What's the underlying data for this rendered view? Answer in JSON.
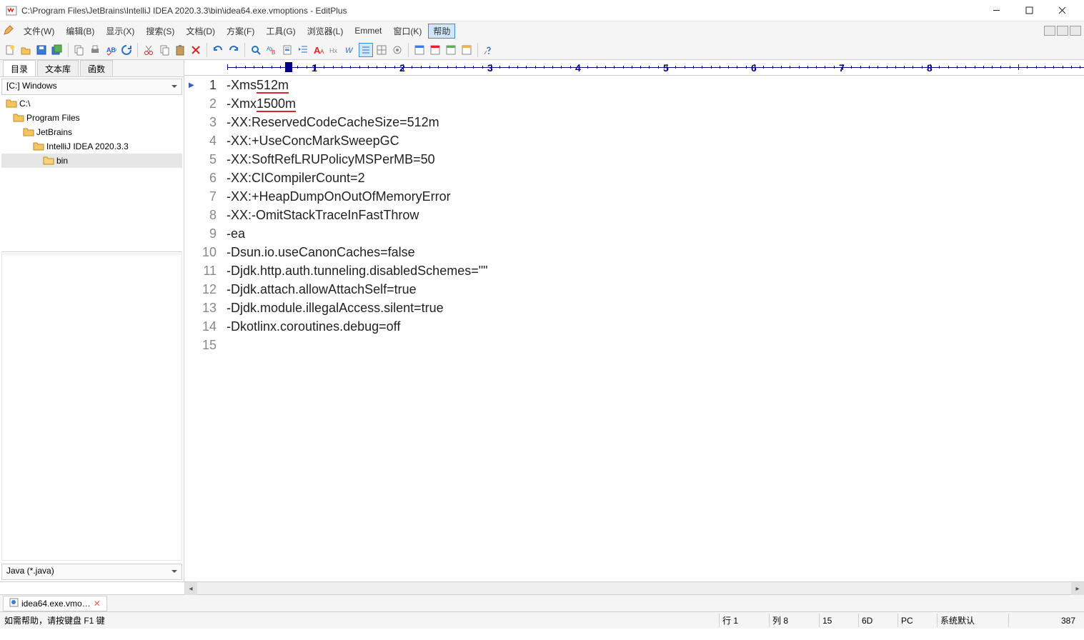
{
  "title": "C:\\Program Files\\JetBrains\\IntelliJ IDEA 2020.3.3\\bin\\idea64.exe.vmoptions - EditPlus",
  "menubar": [
    "文件(W)",
    "编辑(B)",
    "显示(X)",
    "搜索(S)",
    "文档(D)",
    "方案(F)",
    "工具(G)",
    "浏览器(L)",
    "Emmet",
    "窗口(K)",
    "帮助"
  ],
  "side_tabs": {
    "dir": "目录",
    "textlib": "文本库",
    "funcs": "函数"
  },
  "drive_select": "[C:] Windows",
  "tree": [
    {
      "label": "C:\\",
      "depth": 0
    },
    {
      "label": "Program Files",
      "depth": 1
    },
    {
      "label": "JetBrains",
      "depth": 2
    },
    {
      "label": "IntelliJ IDEA 2020.3.3",
      "depth": 3
    },
    {
      "label": "bin",
      "depth": 4,
      "selected": true
    }
  ],
  "filetype": "Java (*.java)",
  "code": {
    "lines": [
      {
        "pre": "-Xms",
        "u": "512m",
        "post": ""
      },
      {
        "pre": "-Xmx",
        "u": "1500m",
        "post": ""
      },
      {
        "pre": "-XX:ReservedCodeCacheSize=512m"
      },
      {
        "pre": "-XX:+UseConcMarkSweepGC"
      },
      {
        "pre": "-XX:SoftRefLRUPolicyMSPerMB=50"
      },
      {
        "pre": "-XX:CICompilerCount=2"
      },
      {
        "pre": "-XX:+HeapDumpOnOutOfMemoryError"
      },
      {
        "pre": "-XX:-OmitStackTraceInFastThrow"
      },
      {
        "pre": "-ea"
      },
      {
        "pre": "-Dsun.io.useCanonCaches=false"
      },
      {
        "pre": "-Djdk.http.auth.tunneling.disabledSchemes=\"\""
      },
      {
        "pre": "-Djdk.attach.allowAttachSelf=true"
      },
      {
        "pre": "-Djdk.module.illegalAccess.silent=true"
      },
      {
        "pre": "-Dkotlinx.coroutines.debug=off"
      },
      {
        "pre": ""
      }
    ]
  },
  "file_tab": "idea64.exe.vmo…",
  "status": {
    "help": "如需帮助，请按键盘 F1 键",
    "line": "行 1",
    "col": "列 8",
    "lines_total": "15",
    "v1": "6D",
    "v2": "PC",
    "enc": "系统默认",
    "v3": "387"
  },
  "ruler_nums": [
    "1",
    "2",
    "3",
    "4",
    "5",
    "6",
    "7",
    "8"
  ],
  "watermark": ""
}
